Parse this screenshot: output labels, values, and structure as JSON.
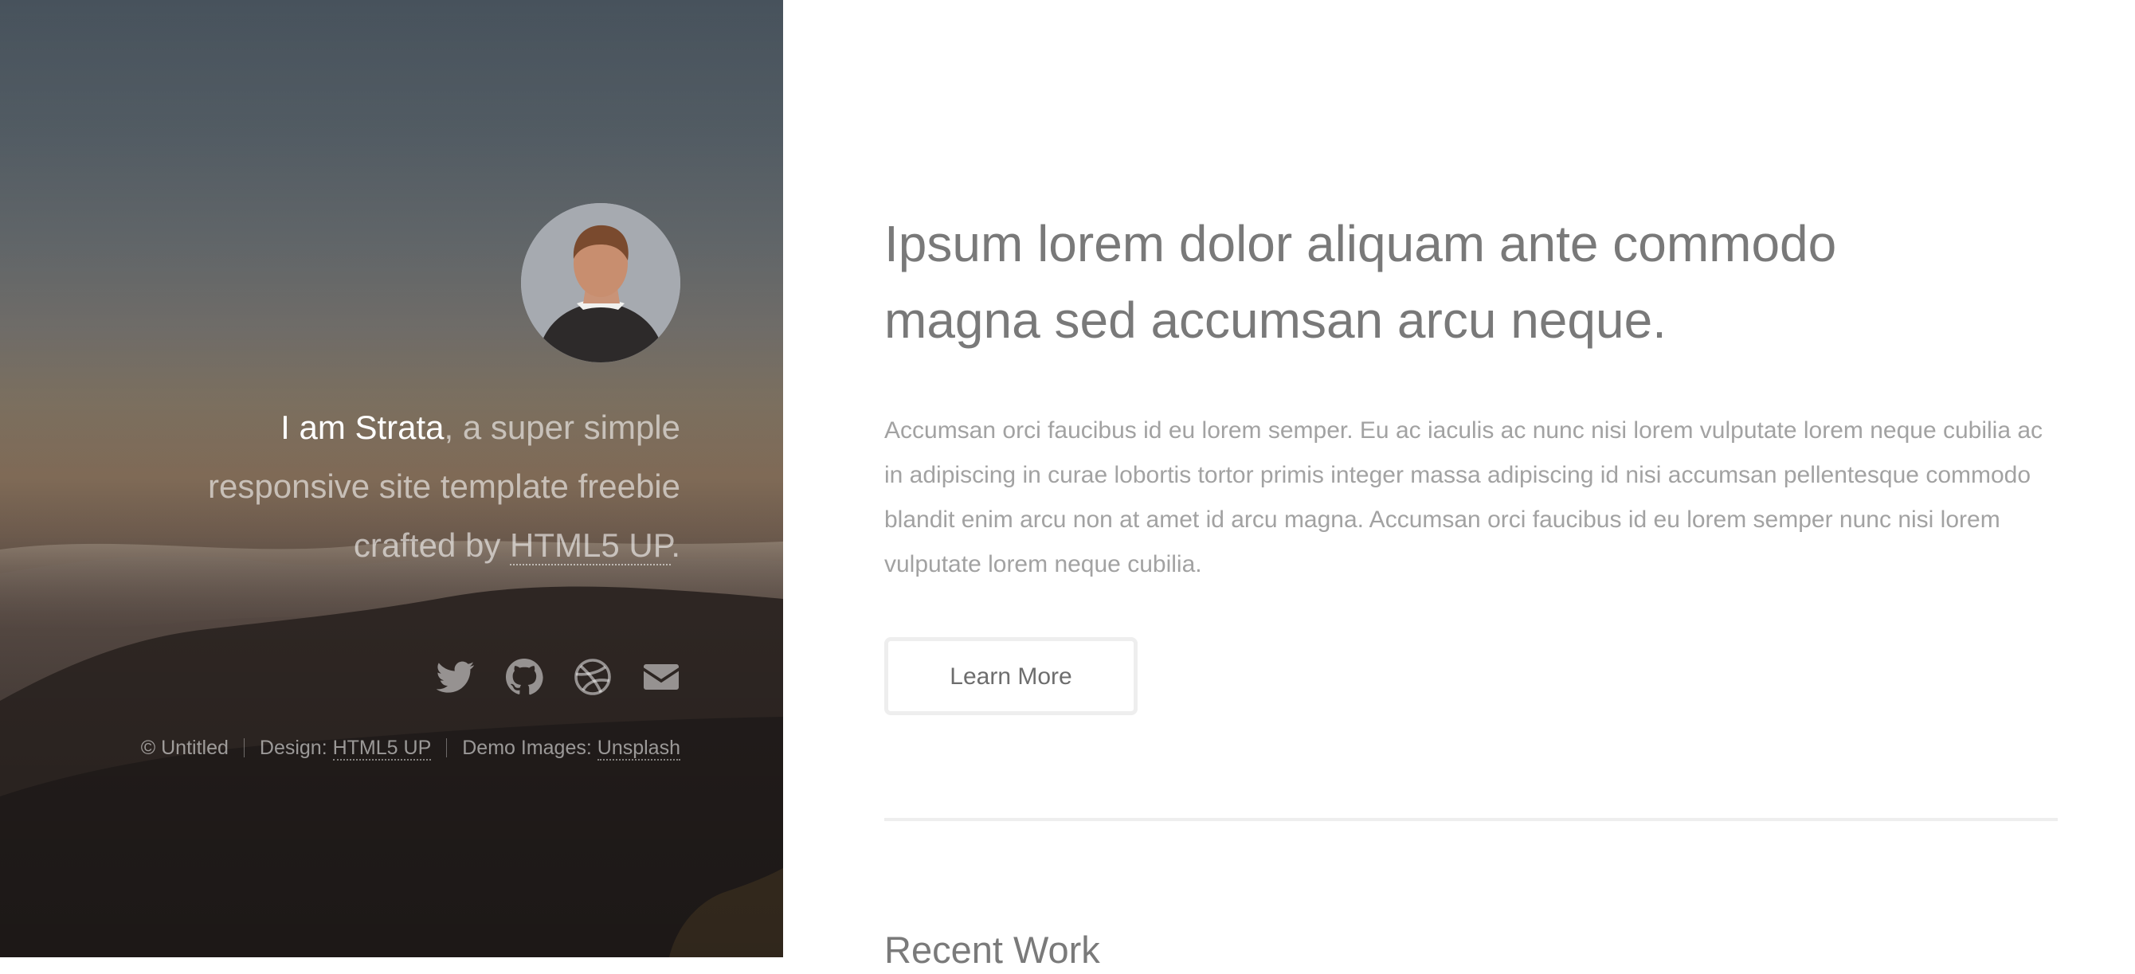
{
  "header": {
    "intro": {
      "name": "I am Strata",
      "rest_line1": ", a super simple",
      "line2": "responsive site template freebie",
      "line3_prefix": "crafted by ",
      "link_text": "HTML5 UP",
      "line3_suffix": "."
    },
    "social": [
      "twitter-icon",
      "github-icon",
      "dribbble-icon",
      "envelope-icon"
    ],
    "copyright": {
      "owner": "© Untitled",
      "design_label": "Design: ",
      "design_link": "HTML5 UP",
      "images_label": "Demo Images: ",
      "images_link": "Unsplash"
    }
  },
  "main": {
    "headline_line1": "Ipsum lorem dolor aliquam ante commodo",
    "headline_line2": "magna sed accumsan arcu neque.",
    "body": "Accumsan orci faucibus id eu lorem semper. Eu ac iaculis ac nunc nisi lorem vulputate lorem neque cubilia ac in adipiscing in curae lobortis tortor primis integer massa adipiscing id nisi accumsan pellentesque commodo blandit enim arcu non at amet id arcu magna. Accumsan orci faucibus id eu lorem semper nunc nisi lorem vulputate lorem neque cubilia.",
    "button_label": "Learn More",
    "section_title": "Recent Work"
  },
  "colors": {
    "headline": "#797979",
    "body_text": "#a2a2a2",
    "button_border": "#eeeeee",
    "divider": "#eeeeee"
  }
}
